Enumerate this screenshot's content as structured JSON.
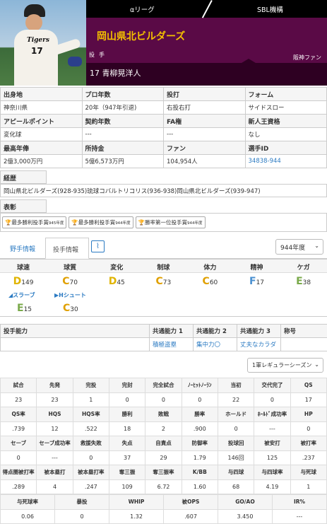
{
  "header": {
    "league": "αリーグ",
    "org": "SBL機構",
    "team": "岡山県北ビルダーズ",
    "position": [
      "投",
      "手"
    ],
    "fan": "阪神ファン",
    "player": "17 青柳晃洋人",
    "photo_logo": "Tigers",
    "photo_number": "17"
  },
  "info": {
    "row1_h": [
      "出身地",
      "プロ年数",
      "投打",
      "フォーム"
    ],
    "row1_v": [
      "神奈川県",
      "20年（947年引退)",
      "右投右打",
      "サイドスロー"
    ],
    "row2_h": [
      "アピールポイント",
      "契約年数",
      "FA権",
      "新人王資格"
    ],
    "row2_v": [
      "変化球",
      "---",
      "---",
      "なし"
    ],
    "row3_h": [
      "最高年俸",
      "所持金",
      "ファン",
      "選手ID"
    ],
    "row3_v": [
      "2億3,000万円",
      "5億6,573万円",
      "104,954人",
      "34838-944"
    ]
  },
  "career": {
    "title": "経歴",
    "text": "岡山県北ビルダーズ(928-935)琉球コバルトリコリス(936-938)岡山県北ビルダーズ(939-947)"
  },
  "awards": {
    "title": "表彰",
    "items": [
      {
        "label": "最多勝利投手賞",
        "year": "945年度"
      },
      {
        "label": "最多勝利投手賞",
        "year": "944年度"
      },
      {
        "label": "勝率第一位投手賞",
        "year": "944年度"
      }
    ]
  },
  "tabs": {
    "fielder": "野手情報",
    "pitcher": "投手情報",
    "season": "944年度"
  },
  "abilities": {
    "headers": [
      "球速",
      "球質",
      "変化",
      "制球",
      "体力",
      "精神",
      "ケガ"
    ],
    "values": [
      {
        "grade": "D",
        "value": "149",
        "color": "#e0b400"
      },
      {
        "grade": "C",
        "value": "70",
        "color": "#e0a000"
      },
      {
        "grade": "D",
        "value": "45",
        "color": "#e0b400"
      },
      {
        "grade": "C",
        "value": "73",
        "color": "#e0a000"
      },
      {
        "grade": "C",
        "value": "60",
        "color": "#e0a000"
      },
      {
        "grade": "F",
        "value": "17",
        "color": "#4a90d0"
      },
      {
        "grade": "E",
        "value": "38",
        "color": "#79a94a"
      }
    ],
    "pitches": [
      {
        "name": "スラーブ",
        "grade": "E",
        "value": "15",
        "color": "#79a94a"
      },
      {
        "name": "Hシュート",
        "grade": "C",
        "value": "30",
        "color": "#e0a000"
      }
    ]
  },
  "abil_table": {
    "headers": [
      "投手能力",
      "共通能力 1",
      "共通能力 2",
      "共通能力 3",
      "称号"
    ],
    "values": [
      "",
      "積極盗塁",
      "集中力〇",
      "丈夫なカラダ",
      ""
    ]
  },
  "season2": "1軍レギュラーシーズン",
  "stats": {
    "r1h": [
      "試合",
      "先発",
      "完投",
      "完封",
      "完全試合",
      "ﾉｰﾋｯﾄﾉｰﾗﾝ",
      "当初",
      "交代完了",
      "QS"
    ],
    "r1v": [
      "23",
      "23",
      "1",
      "0",
      "0",
      "0",
      "22",
      "0",
      "17"
    ],
    "r2h": [
      "QS率",
      "HQS",
      "HQS率",
      "勝利",
      "敗戦",
      "勝率",
      "ホールド",
      "ﾎｰﾙﾄﾞ成功率",
      "HP"
    ],
    "r2v": [
      ".739",
      "12",
      ".522",
      "18",
      "2",
      ".900",
      "0",
      "---",
      "0"
    ],
    "r3h": [
      "セーブ",
      "セーブ成功率",
      "救援失敗",
      "失点",
      "自責点",
      "防御率",
      "投球回",
      "被安打",
      "被打率"
    ],
    "r3v": [
      "0",
      "---",
      "0",
      "37",
      "29",
      "1.79",
      "146回",
      "125",
      ".237"
    ],
    "r4h": [
      "得点圏被打率",
      "被本塁打",
      "被本塁打率",
      "奪三振",
      "奪三振率",
      "K/BB",
      "与四球",
      "与四球率",
      "与死球"
    ],
    "r4v": [
      ".289",
      "4",
      ".247",
      "109",
      "6.72",
      "1.60",
      "68",
      "4.19",
      "1"
    ],
    "r5h": [
      "与死球率",
      "暴投",
      "WHIP",
      "被OPS",
      "GO/AO",
      "IR%"
    ],
    "r5v": [
      "0.06",
      "0",
      "1.32",
      ".607",
      "3.450",
      "---"
    ]
  }
}
